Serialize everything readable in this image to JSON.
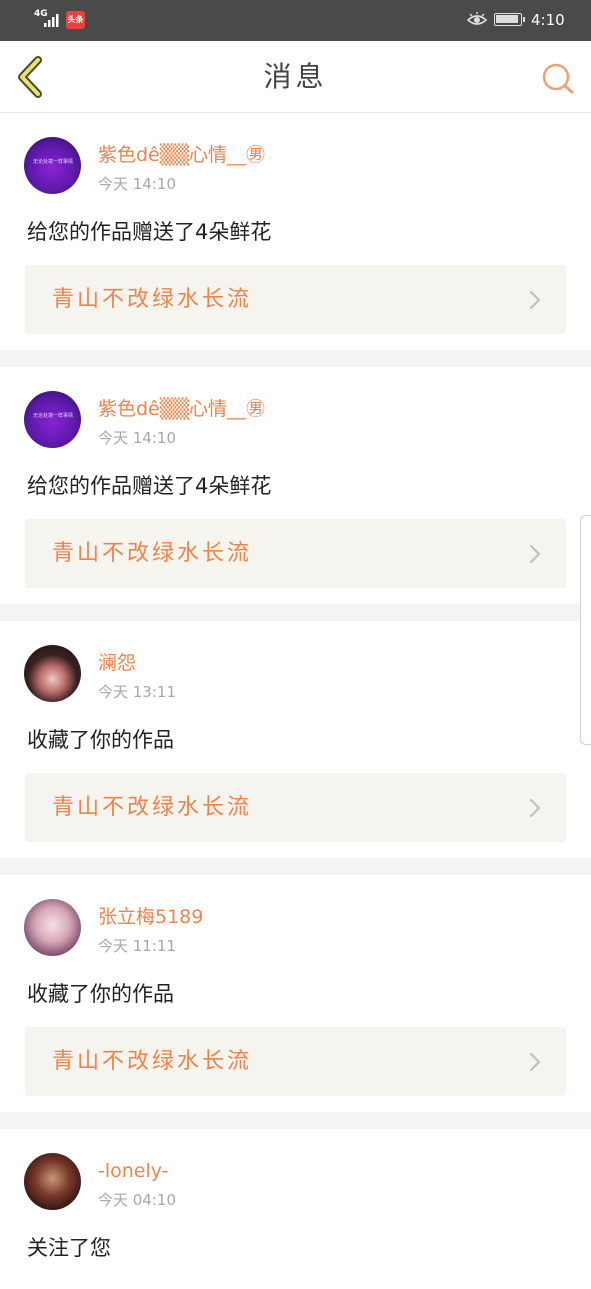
{
  "status_bar": {
    "network": "4G",
    "app_badge": "头条",
    "time": "4:10"
  },
  "header": {
    "title": "消息",
    "back_icon": "chevron-left-icon",
    "search_icon": "search-icon"
  },
  "messages": [
    {
      "name": "紫色dê▒▒心情__㊚",
      "time": "今天 14:10",
      "action": "给您的作品赠送了4朵鲜花",
      "work": "青山不改绿水长流",
      "avatar_text": "无论处境一样事情"
    },
    {
      "name": "紫色dê▒▒心情__㊚",
      "time": "今天 14:10",
      "action": "给您的作品赠送了4朵鲜花",
      "work": "青山不改绿水长流",
      "avatar_text": "无论处境一样事情"
    },
    {
      "name": "澜怨",
      "time": "今天 13:11",
      "action": "收藏了你的作品",
      "work": "青山不改绿水长流"
    },
    {
      "name": "张立梅5189",
      "time": "今天 11:11",
      "action": "收藏了你的作品",
      "work": "青山不改绿水长流"
    },
    {
      "name": "-lonely-",
      "time": "今天 04:10",
      "action": "关注了您"
    }
  ],
  "colors": {
    "accent": "#f0834a",
    "status_bar": "#4a4a4a",
    "work_box": "#f5f4ee",
    "divider": "#f4f4f4"
  }
}
